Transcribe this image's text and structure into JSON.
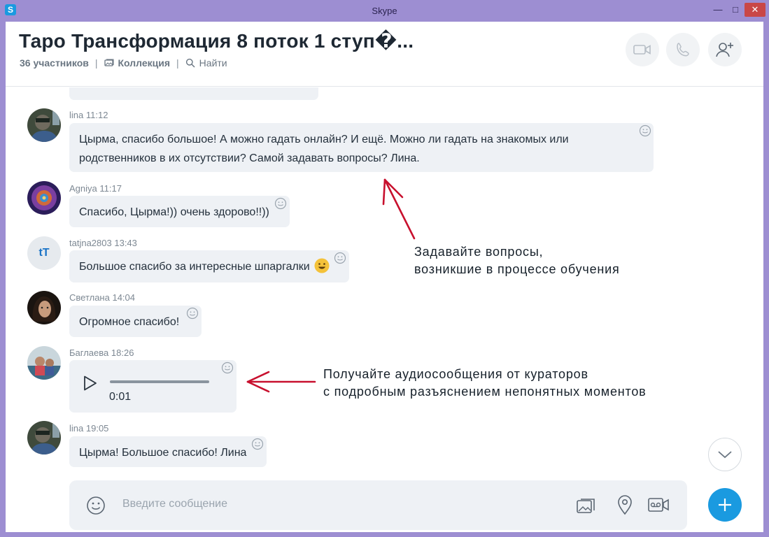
{
  "window": {
    "title": "Skype"
  },
  "chat": {
    "title": "Таро Трансформация 8 поток 1 ступ�...",
    "participants": "36 участников",
    "collection": "Коллекция",
    "find": "Найти"
  },
  "messages": [
    {
      "author": "lina",
      "time": "11:12",
      "text_lines": [
        "Цырма, спасибо большое! А можно гадать онлайн? И ещё. Можно ли гадать на знакомых или",
        "родственников в их отсутствии? Самой задавать вопросы? Лина."
      ]
    },
    {
      "author": "Agniya",
      "time": "11:17",
      "text": "Спасибо, Цырма!)) очень здорово!!))"
    },
    {
      "author": "tatjna2803",
      "time": "13:43",
      "text": "Большое спасибо за интересные шпаргалки",
      "avatar_initials": "tT"
    },
    {
      "author": "Светлана",
      "time": "14:04",
      "text": "Огромное спасибо!"
    },
    {
      "author": "Баглаева",
      "time": "18:26",
      "audio_duration": "0:01"
    },
    {
      "author": "lina",
      "time": "19:05",
      "text": "Цырма! Большое спасибо! Лина"
    }
  ],
  "annotations": {
    "questions": [
      "Задавайте вопросы,",
      "возникшие в процессе обучения"
    ],
    "audio": [
      "Получайте аудиосообщения от кураторов",
      "с подробным разъяснением непонятных моментов"
    ]
  },
  "composer": {
    "placeholder": "Введите сообщение"
  },
  "colors": {
    "accent": "#1a9ae0",
    "arrow": "#c8102e",
    "bubble": "#eef1f5",
    "frame": "#9d8ed2"
  },
  "icons": [
    "skype-icon",
    "video-call-icon",
    "audio-call-icon",
    "add-person-icon",
    "collection-icon",
    "search-icon",
    "emoji-icon",
    "play-icon",
    "image-icon",
    "location-icon",
    "video-message-icon",
    "chevron-down-icon",
    "plus-icon"
  ]
}
